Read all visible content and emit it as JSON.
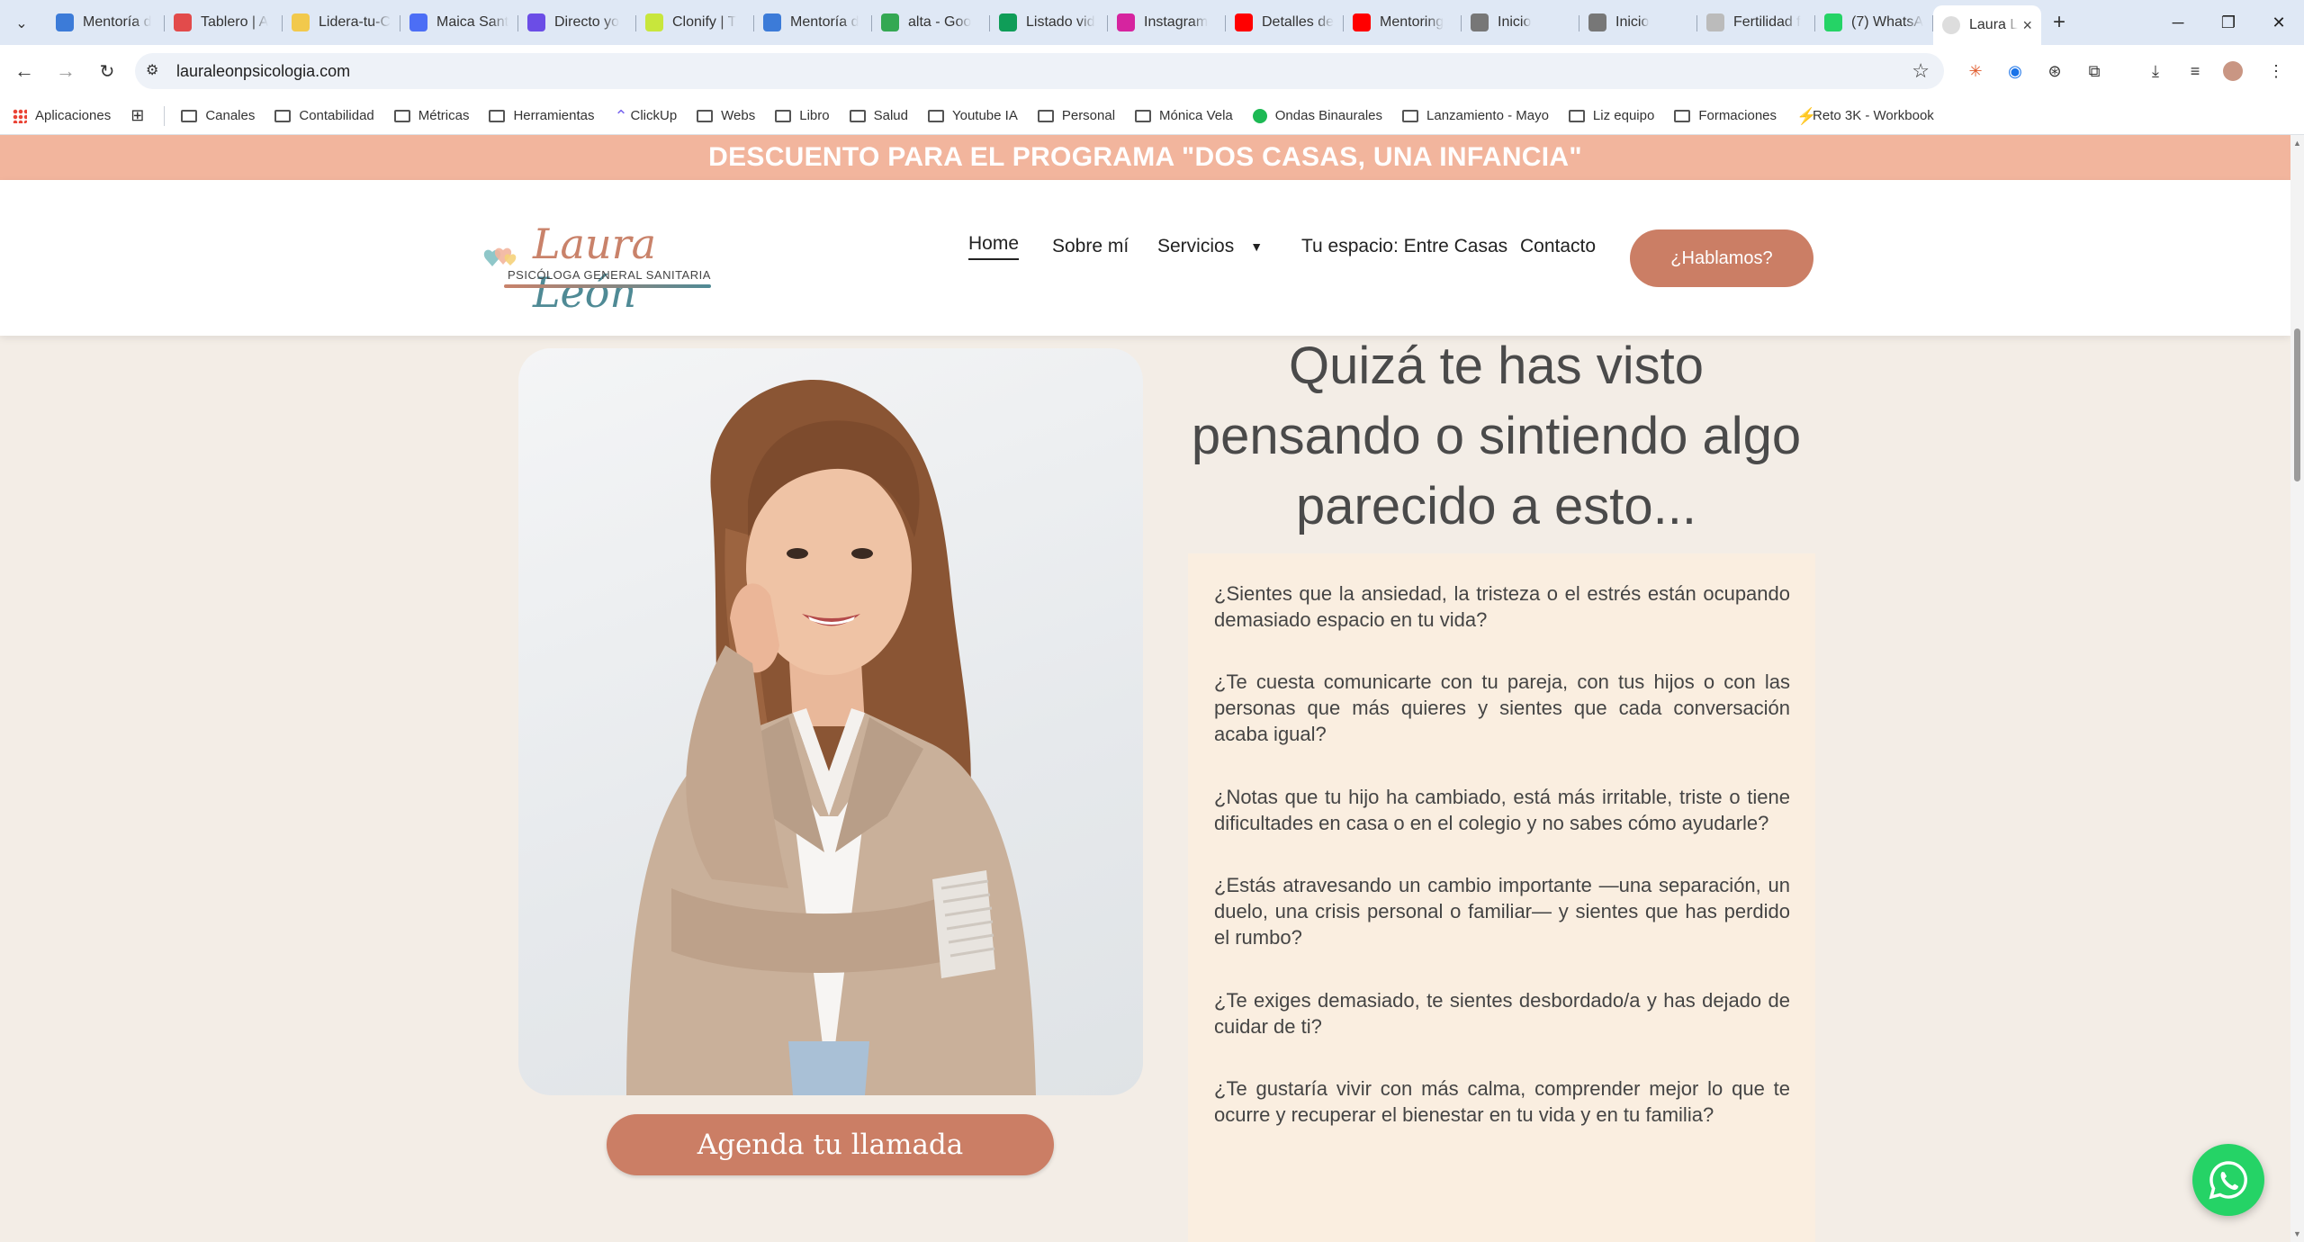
{
  "browser": {
    "tabs": [
      {
        "title": "Mentoría d",
        "icon": "s-logo-icon",
        "color": "#3c7bd8"
      },
      {
        "title": "Tablero | A",
        "icon": "tablero-icon",
        "color": "#e24b4b"
      },
      {
        "title": "Lidera-tu-C",
        "icon": "sticky-note-icon",
        "color": "#f2c94c"
      },
      {
        "title": "Maica Sant",
        "icon": "c-logo-icon",
        "color": "#4c6ef5"
      },
      {
        "title": "Directo yo",
        "icon": "chat-bubble-icon",
        "color": "#6b4de6"
      },
      {
        "title": "Clonify | T",
        "icon": "clonify-icon",
        "color": "#c8e63c"
      },
      {
        "title": "Mentoría d",
        "icon": "s-logo-icon",
        "color": "#3c7bd8"
      },
      {
        "title": "alta - Goo",
        "icon": "google-drive-icon",
        "color": "#34a853"
      },
      {
        "title": "Listado vid",
        "icon": "sheets-icon",
        "color": "#0f9d58"
      },
      {
        "title": "Instagram",
        "icon": "instagram-icon",
        "color": "#d6249f"
      },
      {
        "title": "Detalles de",
        "icon": "youtube-icon",
        "color": "#ff0000"
      },
      {
        "title": "Mentoring",
        "icon": "youtube-icon",
        "color": "#ff0000"
      },
      {
        "title": "Inicio",
        "icon": "globe-icon",
        "color": "#777777"
      },
      {
        "title": "Inicio",
        "icon": "globe-icon",
        "color": "#777777"
      },
      {
        "title": "Fertilidad f",
        "icon": "page-icon",
        "color": "#bbbbbb"
      },
      {
        "title": "(7) WhatsA",
        "icon": "whatsapp-icon",
        "color": "#25d366"
      }
    ],
    "active_tab": {
      "title": "Laura L",
      "icon": "site-icon"
    },
    "url": "lauraleonpsicologia.com",
    "bookmarks": [
      {
        "label": "Aplicaciones",
        "icon": "apps-grid-icon"
      },
      {
        "label": "Canales",
        "icon": "folder-icon"
      },
      {
        "label": "Contabilidad",
        "icon": "folder-icon"
      },
      {
        "label": "Métricas",
        "icon": "folder-icon"
      },
      {
        "label": "Herramientas",
        "icon": "folder-icon"
      },
      {
        "label": "ClickUp",
        "icon": "clickup-icon"
      },
      {
        "label": "Webs",
        "icon": "folder-icon"
      },
      {
        "label": "Libro",
        "icon": "folder-icon"
      },
      {
        "label": "Salud",
        "icon": "folder-icon"
      },
      {
        "label": "Youtube IA",
        "icon": "folder-icon"
      },
      {
        "label": "Personal",
        "icon": "folder-icon"
      },
      {
        "label": "Mónica Vela",
        "icon": "folder-icon"
      },
      {
        "label": "Ondas Binaurales",
        "icon": "spotify-icon"
      },
      {
        "label": "Lanzamiento - Mayo",
        "icon": "folder-icon"
      },
      {
        "label": "Liz equipo",
        "icon": "folder-icon"
      },
      {
        "label": "Formaciones",
        "icon": "folder-icon"
      },
      {
        "label": "Reto 3K - Workbook",
        "icon": "make-icon"
      }
    ]
  },
  "site": {
    "promo_banner": "DESCUENTO PARA EL PROGRAMA \"DOS CASAS, UNA INFANCIA\"",
    "logo": {
      "name_first": "Laura",
      "name_second": "León",
      "tagline": "PSICÓLOGA GENERAL SANITARIA"
    },
    "nav": {
      "home": "Home",
      "about": "Sobre mí",
      "services": "Servicios",
      "space": "Tu espacio: Entre Casas",
      "contact": "Contacto",
      "cta": "¿Hablamos?"
    },
    "headline": "Quizá te has visto pensando o sintiendo algo parecido a esto...",
    "questions": [
      "¿Sientes que la ansiedad, la tristeza o el estrés están ocupando demasiado espacio en tu vida?",
      "¿Te cuesta comunicarte con tu pareja, con tus hijos o con las personas que más quieres y sientes que cada conversación acaba igual?",
      "¿Notas que tu hijo ha cambiado, está más irritable, triste o tiene dificultades en casa o en el colegio y no sabes cómo ayudarle?",
      "¿Estás atravesando un cambio importante —una separación, un duelo, una crisis personal o familiar— y sientes que has perdido el rumbo?",
      "¿Te exiges demasiado, te sientes desbordado/a y has dejado de cuidar de ti?",
      "¿Te gustaría vivir con más calma, comprender mejor lo que te ocurre y recuperar el bienestar en tu vida y en tu familia?"
    ],
    "cta_main": "Agenda tu llamada",
    "colors": {
      "accent": "#cb7e65",
      "banner": "#f2b59d",
      "background": "#f3ede6",
      "question_box": "#faeee0",
      "whatsapp": "#25d366"
    }
  }
}
